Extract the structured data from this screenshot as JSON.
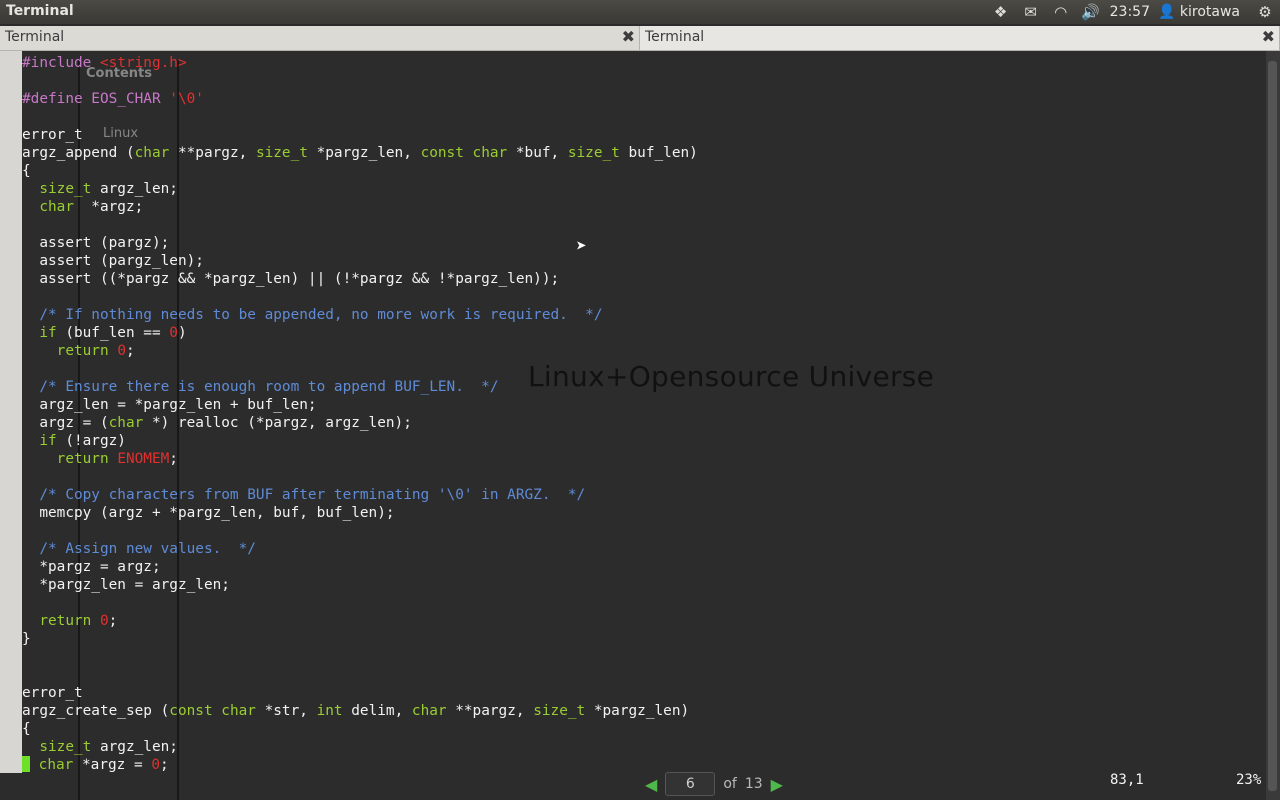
{
  "panel": {
    "title": "Terminal",
    "clock": "23:57",
    "user": "kirotawa"
  },
  "tabs": [
    {
      "label": "Terminal"
    },
    {
      "label": "Terminal"
    }
  ],
  "ghost": {
    "contents": "Contents",
    "linux": "Linux"
  },
  "code_lines": [
    "<span class=\"pp\">#include </span><span class=\"str\">&lt;string.h&gt;</span>",
    "",
    "<span class=\"pp\">#define EOS_CHAR </span><span class=\"str\">'\\0'</span>",
    "",
    "error_t",
    "argz_append (<span class=\"kw\">char</span> **pargz, <span class=\"kw\">size_t</span> *pargz_len, <span class=\"kw\">const char</span> *buf, <span class=\"kw\">size_t</span> buf_len)",
    "{",
    "  <span class=\"kw\">size_t</span> argz_len;",
    "  <span class=\"kw\">char</span>  *argz;",
    "",
    "  assert (pargz);",
    "  assert (pargz_len);",
    "  assert ((*pargz &amp;&amp; *pargz_len) || (!*pargz &amp;&amp; !*pargz_len));",
    "",
    "  <span class=\"cm\">/* If nothing needs to be appended, no more work is required.  */</span>",
    "  <span class=\"kw\">if</span> (buf_len == <span class=\"num\">0</span>)",
    "    <span class=\"kw\">return</span> <span class=\"num\">0</span>;",
    "",
    "  <span class=\"cm\">/* Ensure there is enough room to append BUF_LEN.  */</span>",
    "  argz_len = *pargz_len + buf_len;",
    "  argz = (<span class=\"kw\">char</span> *) realloc (*pargz, argz_len);",
    "  <span class=\"kw\">if</span> (!argz)",
    "    <span class=\"kw\">return</span> <span class=\"str\">ENOMEM</span>;",
    "",
    "  <span class=\"cm\">/* Copy characters from BUF after terminating '\\0' in ARGZ.  */</span>",
    "  memcpy (argz + *pargz_len, buf, buf_len);",
    "",
    "  <span class=\"cm\">/* Assign new values.  */</span>",
    "  *pargz = argz;",
    "  *pargz_len = argz_len;",
    "",
    "  <span class=\"kw\">return</span> <span class=\"num\">0</span>;",
    "}",
    "",
    "",
    "error_t",
    "argz_create_sep (<span class=\"kw\">const char</span> *str, <span class=\"kw\">int</span> delim, <span class=\"kw\">char</span> **pargz, <span class=\"kw\">size_t</span> *pargz_len)",
    "{",
    "  <span class=\"kw\">size_t</span> argz_len;",
    "<span class=\"cursor\"></span> <span class=\"kw\">char</span> *argz = <span class=\"num\">0</span>;"
  ],
  "watermark": "Linux+Opensource Universe",
  "pager": {
    "page": "6",
    "of": "of",
    "total": "13"
  },
  "status": {
    "position": "83,1",
    "percent": "23%"
  }
}
